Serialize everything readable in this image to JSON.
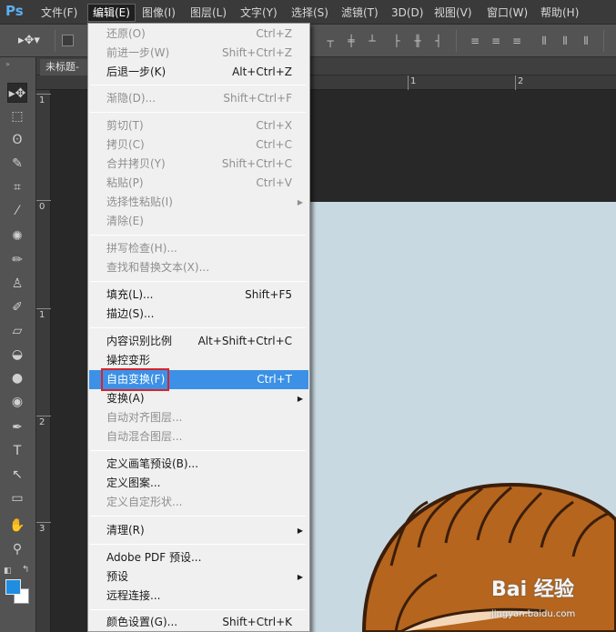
{
  "app": {
    "logo": "Ps"
  },
  "menubar": {
    "items": [
      {
        "label": "文件(F)"
      },
      {
        "label": "编辑(E)"
      },
      {
        "label": "图像(I)"
      },
      {
        "label": "图层(L)"
      },
      {
        "label": "文字(Y)"
      },
      {
        "label": "选择(S)"
      },
      {
        "label": "滤镜(T)"
      },
      {
        "label": "3D(D)"
      },
      {
        "label": "视图(V)"
      },
      {
        "label": "窗口(W)"
      },
      {
        "label": "帮助(H)"
      }
    ],
    "active_item": "编辑(E)"
  },
  "document": {
    "tab_label": "未标题-"
  },
  "rulers": {
    "top": [
      "1",
      "2"
    ],
    "left": [
      "1",
      "0",
      "1",
      "2",
      "3"
    ]
  },
  "edit_menu": {
    "items": [
      {
        "label": "还原(O)",
        "shortcut": "Ctrl+Z",
        "enabled": false
      },
      {
        "label": "前进一步(W)",
        "shortcut": "Shift+Ctrl+Z",
        "enabled": false
      },
      {
        "label": "后退一步(K)",
        "shortcut": "Alt+Ctrl+Z",
        "enabled": true
      },
      {
        "label": "渐隐(D)...",
        "shortcut": "Shift+Ctrl+F",
        "enabled": false
      },
      {
        "label": "剪切(T)",
        "shortcut": "Ctrl+X",
        "enabled": false
      },
      {
        "label": "拷贝(C)",
        "shortcut": "Ctrl+C",
        "enabled": false
      },
      {
        "label": "合并拷贝(Y)",
        "shortcut": "Shift+Ctrl+C",
        "enabled": false
      },
      {
        "label": "粘贴(P)",
        "shortcut": "Ctrl+V",
        "enabled": false
      },
      {
        "label": "选择性粘贴(I)",
        "shortcut": "",
        "enabled": false,
        "submenu": true
      },
      {
        "label": "清除(E)",
        "shortcut": "",
        "enabled": false
      },
      {
        "label": "拼写检查(H)...",
        "shortcut": "",
        "enabled": false
      },
      {
        "label": "查找和替换文本(X)...",
        "shortcut": "",
        "enabled": false
      },
      {
        "label": "填充(L)...",
        "shortcut": "Shift+F5",
        "enabled": true
      },
      {
        "label": "描边(S)...",
        "shortcut": "",
        "enabled": true
      },
      {
        "label": "内容识别比例",
        "shortcut": "Alt+Shift+Ctrl+C",
        "enabled": true
      },
      {
        "label": "操控变形",
        "shortcut": "",
        "enabled": true
      },
      {
        "label": "自由变换(F)",
        "shortcut": "Ctrl+T",
        "enabled": true,
        "highlighted": true
      },
      {
        "label": "变换(A)",
        "shortcut": "",
        "enabled": true,
        "submenu": true
      },
      {
        "label": "自动对齐图层...",
        "shortcut": "",
        "enabled": false
      },
      {
        "label": "自动混合图层...",
        "shortcut": "",
        "enabled": false
      },
      {
        "label": "定义画笔预设(B)...",
        "shortcut": "",
        "enabled": true
      },
      {
        "label": "定义图案...",
        "shortcut": "",
        "enabled": true
      },
      {
        "label": "定义自定形状...",
        "shortcut": "",
        "enabled": false
      },
      {
        "label": "清理(R)",
        "shortcut": "",
        "enabled": true,
        "submenu": true
      },
      {
        "label": "Adobe PDF 预设...",
        "shortcut": "",
        "enabled": true
      },
      {
        "label": "预设",
        "shortcut": "",
        "enabled": true,
        "submenu": true
      },
      {
        "label": "远程连接...",
        "shortcut": "",
        "enabled": true
      },
      {
        "label": "颜色设置(G)...",
        "shortcut": "Shift+Ctrl+K",
        "enabled": true
      }
    ]
  },
  "tools": [
    {
      "icon": "move-tool-icon"
    },
    {
      "icon": "marquee-tool-icon"
    },
    {
      "icon": "lasso-tool-icon"
    },
    {
      "icon": "quick-select-tool-icon"
    },
    {
      "icon": "crop-tool-icon"
    },
    {
      "icon": "eyedropper-tool-icon"
    },
    {
      "icon": "healing-brush-tool-icon"
    },
    {
      "icon": "brush-tool-icon"
    },
    {
      "icon": "clone-stamp-tool-icon"
    },
    {
      "icon": "history-brush-tool-icon"
    },
    {
      "icon": "eraser-tool-icon"
    },
    {
      "icon": "paint-bucket-tool-icon"
    },
    {
      "icon": "blur-tool-icon"
    },
    {
      "icon": "dodge-tool-icon"
    },
    {
      "icon": "pen-tool-icon"
    },
    {
      "icon": "type-tool-icon"
    },
    {
      "icon": "path-select-tool-icon"
    },
    {
      "icon": "shape-tool-icon"
    },
    {
      "icon": "hand-tool-icon"
    },
    {
      "icon": "zoom-tool-icon"
    }
  ],
  "colors": {
    "foreground": "#1f8de0",
    "background": "#ffffff",
    "highlight": "#3c91e6",
    "callout": "#d8232a",
    "canvas": "#c9d9e2",
    "hair": "#b5651d"
  },
  "watermark": {
    "brand": "Bai 经验",
    "url": "jingyan.baidu.com"
  }
}
